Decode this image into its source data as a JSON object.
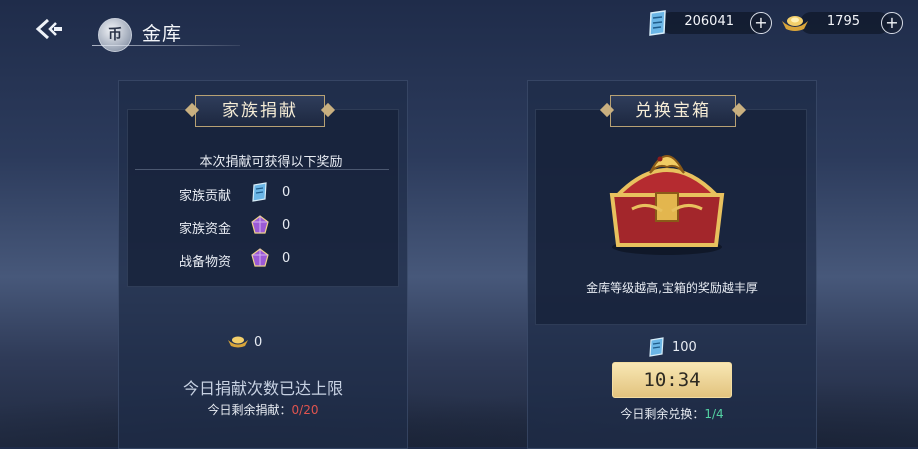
{
  "header": {
    "title": "金库",
    "bag_glyph": "币"
  },
  "resources": [
    {
      "icon": "blue-scroll-icon",
      "value": "206041"
    },
    {
      "icon": "gold-ingot-icon",
      "value": "1795"
    }
  ],
  "donate": {
    "title": "家族捐献",
    "subtitle": "本次捐献可获得以下奖励",
    "rewards": [
      {
        "label": "家族贡献",
        "icon": "blue-scroll-icon",
        "value": "0"
      },
      {
        "label": "家族资金",
        "icon": "purple-gem-icon",
        "value": "0"
      },
      {
        "label": "战备物资",
        "icon": "purple-gem-icon",
        "value": "0"
      }
    ],
    "cost": "0",
    "limit_text": "今日捐献次数已达上限",
    "remaining_label": "今日剩余捐献：",
    "remaining_value": "0/20"
  },
  "exchange": {
    "title": "兑换宝箱",
    "desc": "金库等级越高,宝箱的奖励越丰厚",
    "cost": "100",
    "timer": "10:34",
    "remaining_label": "今日剩余兑换：",
    "remaining_value": "1/4"
  },
  "colors": {
    "accent_gold": "#c9b080",
    "remaining_red": "#e0544f",
    "remaining_green": "#53d1a2"
  }
}
